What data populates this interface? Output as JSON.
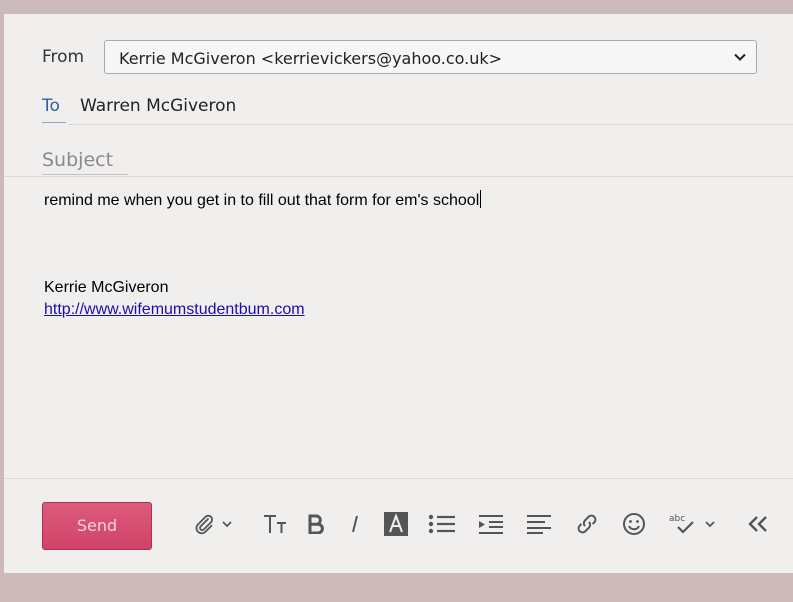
{
  "header": {
    "from_label": "From",
    "from_value": "Kerrie McGiveron <kerrievickers@yahoo.co.uk>",
    "to_label": "To",
    "to_value": "Warren McGiveron"
  },
  "subject": {
    "value": "",
    "placeholder": "Subject"
  },
  "message": {
    "body": "remind me when you get in to fill out that form for em's school",
    "signature_name": "Kerrie McGiveron",
    "signature_link": "http://www.wifemumstudentbum.com"
  },
  "toolbar": {
    "send_label": "Send",
    "icons": [
      "paperclip-icon",
      "chevron-down-icon",
      "text-size-icon",
      "bold-icon",
      "italic-icon",
      "text-color-icon",
      "bullet-list-icon",
      "indent-icon",
      "align-left-icon",
      "link-icon",
      "emoji-icon",
      "spellcheck-icon",
      "chevron-down-icon",
      "collapse-icon"
    ]
  },
  "colors": {
    "accent": "#d04369",
    "link": "#1a0dab",
    "to_label": "#2f5f9a"
  }
}
